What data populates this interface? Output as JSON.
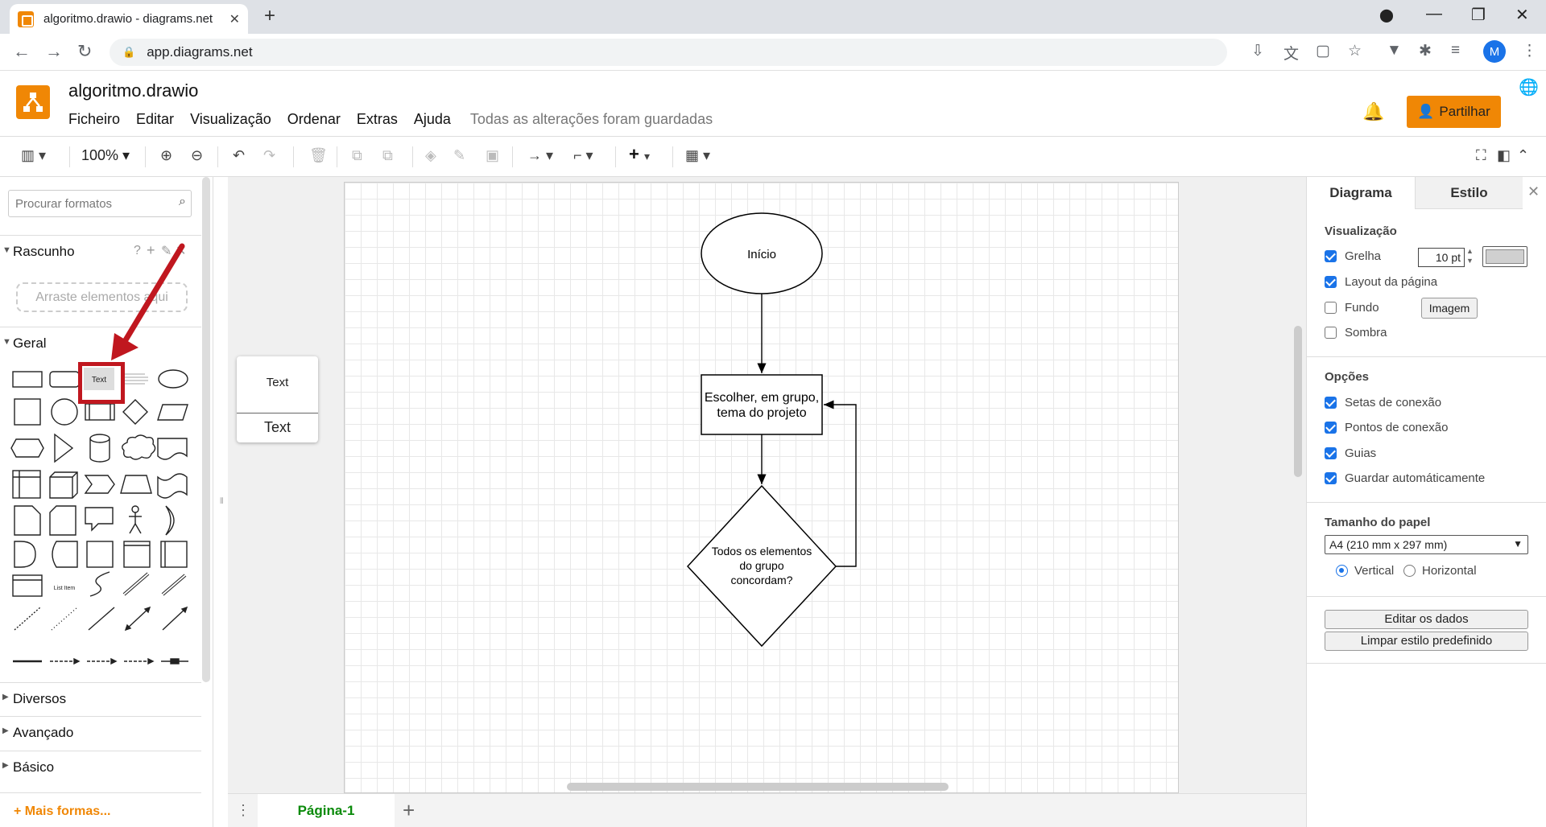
{
  "browser": {
    "tab_title": "algoritmo.drawio - diagrams.net",
    "url": "app.diagrams.net",
    "profile_initial": "M"
  },
  "app": {
    "filename": "algoritmo.drawio",
    "menu": [
      "Ficheiro",
      "Editar",
      "Visualização",
      "Ordenar",
      "Extras",
      "Ajuda"
    ],
    "save_status": "Todas as alterações foram guardadas",
    "share_label": "Partilhar"
  },
  "toolbar": {
    "zoom": "100%"
  },
  "sidebar": {
    "search_placeholder": "Procurar formatos",
    "scratchpad_title": "Rascunho",
    "scratchpad_drop": "Arraste elementos aqui",
    "general_title": "Geral",
    "text_shape_label": "Text",
    "list_item_label": "List Item",
    "sections": [
      "Diversos",
      "Avançado",
      "Básico"
    ],
    "more_shapes": "+ Mais formas..."
  },
  "canvas": {
    "popup_text_small": "Text",
    "popup_text_large": "Text",
    "nodes": {
      "start": "Início",
      "process_line1": "Escolher, em grupo,",
      "process_line2": "tema do projeto",
      "decision_line1": "Todos os elementos",
      "decision_line2": "do grupo",
      "decision_line3": "concordam?"
    }
  },
  "pages": {
    "current": "Página-1"
  },
  "format_panel": {
    "tab_diagram": "Diagrama",
    "tab_style": "Estilo",
    "view_title": "Visualização",
    "grid_label": "Grelha",
    "grid_size": "10 pt",
    "page_layout_label": "Layout da página",
    "background_label": "Fundo",
    "image_button": "Imagem",
    "shadow_label": "Sombra",
    "options_title": "Opções",
    "connection_arrows": "Setas de conexão",
    "connection_points": "Pontos de conexão",
    "guides": "Guias",
    "autosave": "Guardar automáticamente",
    "paper_size_title": "Tamanho do papel",
    "paper_size_value": "A4 (210 mm x 297 mm)",
    "portrait": "Vertical",
    "landscape": "Horizontal",
    "edit_data_button": "Editar os dados",
    "clear_style_button": "Limpar estilo predefinido"
  },
  "colors": {
    "accent": "#f08705",
    "highlight": "#c0171f",
    "checkbox": "#1a73e8",
    "page_tab_text": "#0a8a0a"
  }
}
